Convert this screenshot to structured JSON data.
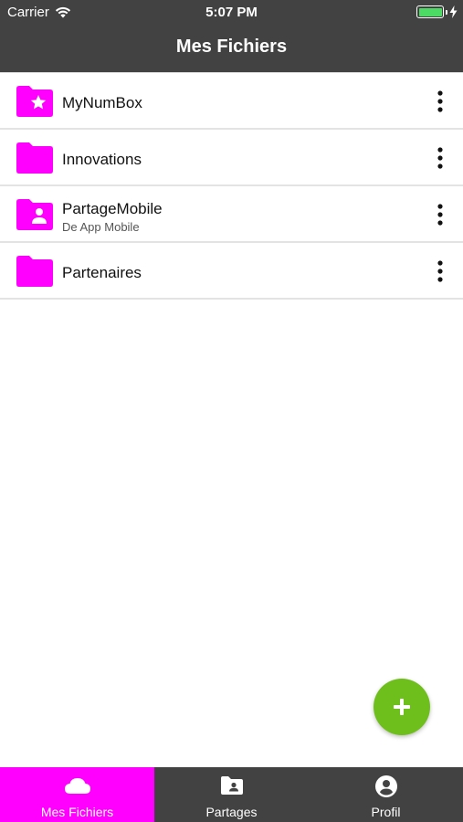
{
  "status": {
    "carrier": "Carrier",
    "time": "5:07 PM"
  },
  "header": {
    "title": "Mes Fichiers"
  },
  "files": [
    {
      "name": "MyNumBox",
      "subtitle": "",
      "icon": "folder-star-icon"
    },
    {
      "name": "Innovations",
      "subtitle": "",
      "icon": "folder-icon"
    },
    {
      "name": "PartageMobile",
      "subtitle": "De App Mobile",
      "icon": "folder-shared-icon"
    },
    {
      "name": "Partenaires",
      "subtitle": "",
      "icon": "folder-icon"
    }
  ],
  "tabs": [
    {
      "label": "Mes Fichiers",
      "icon": "cloud-icon",
      "active": true
    },
    {
      "label": "Partages",
      "icon": "shared-folder-icon",
      "active": false
    },
    {
      "label": "Profil",
      "icon": "account-circle-icon",
      "active": false
    }
  ],
  "colors": {
    "accent": "#ff00ff",
    "bars": "#424242",
    "fab": "#6fbf1c",
    "battery": "#4cd964"
  }
}
